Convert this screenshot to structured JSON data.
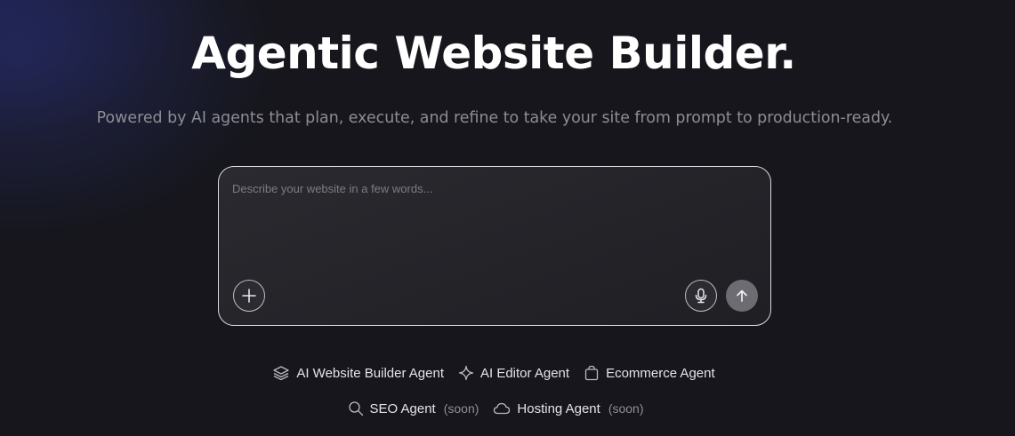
{
  "hero": {
    "title": "Agentic Website Builder.",
    "subtitle": "Powered by AI agents that plan, execute, and refine to take your site from prompt to production-ready."
  },
  "prompt": {
    "placeholder": "Describe your website in a few words...",
    "value": "",
    "add_icon": "plus-icon",
    "mic_icon": "microphone-icon",
    "send_icon": "arrow-up-icon"
  },
  "agents": [
    {
      "label": "AI Website Builder Agent",
      "icon": "layers-icon",
      "soon": ""
    },
    {
      "label": "AI Editor Agent",
      "icon": "sparkle-icon",
      "soon": ""
    },
    {
      "label": "Ecommerce Agent",
      "icon": "shopping-bag-icon",
      "soon": ""
    },
    {
      "label": "SEO Agent",
      "icon": "search-icon",
      "soon": "(soon)"
    },
    {
      "label": "Hosting Agent",
      "icon": "cloud-icon",
      "soon": "(soon)"
    }
  ],
  "colors": {
    "background": "#16161c",
    "accent_glow": "#2a3076",
    "prompt_border": "#d9d9de",
    "send_button": "#6c6c72",
    "subtitle_text": "#8d8d95"
  }
}
